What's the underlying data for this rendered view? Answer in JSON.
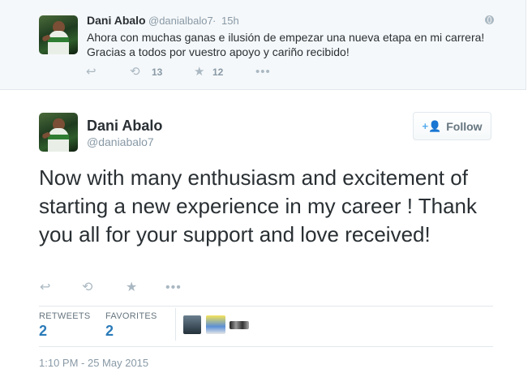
{
  "parent_tweet": {
    "name": "Dani Abalo",
    "handle": "@danialbalo7",
    "dot": "·",
    "time": "15h",
    "text": "Ahora con muchas ganas e ilusión de empezar una nueva etapa en mi carrera! Gracias a todos por vuestro apoyo y cariño recibido!",
    "retweet_count": "13",
    "favorite_count": "12"
  },
  "main_tweet": {
    "name": "Dani Abalo",
    "handle": "@daniabalo7",
    "follow_label": "Follow",
    "text": "Now with many enthusiasm and excitement of starting a new experience in my career ! Thank you all for your support and love received!",
    "stats": {
      "retweets_label": "RETWEETS",
      "retweets_value": "2",
      "favorites_label": "FAVORITES",
      "favorites_value": "2"
    },
    "timestamp": "1:10 PM - 25 May 2015"
  },
  "icons": {
    "reply": "reply-icon",
    "retweet": "retweet-icon",
    "favorite": "star-icon",
    "more": "more-icon",
    "globe": "globe-icon",
    "follow": "add-user-icon"
  },
  "colors": {
    "accent": "#55acee",
    "link": "#2b7bb9",
    "muted": "#8899a6",
    "text": "#292f33",
    "parent_bg": "#f5f8fa"
  }
}
